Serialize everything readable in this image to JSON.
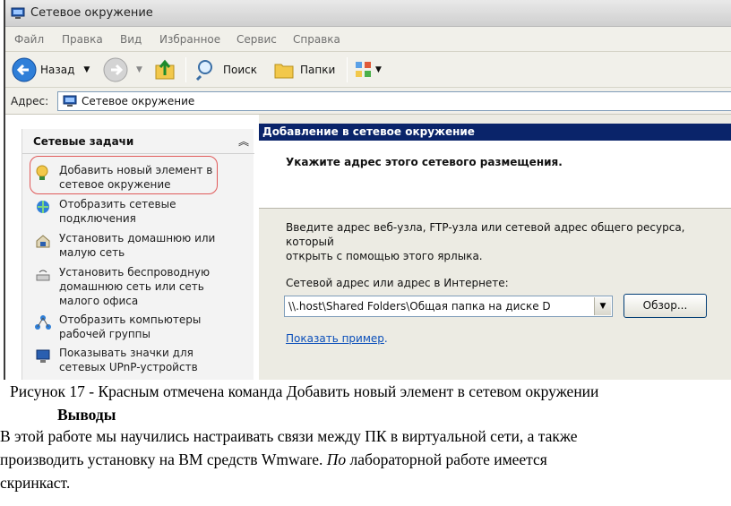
{
  "window": {
    "title": "Сетевое окружение"
  },
  "menu": [
    "Файл",
    "Правка",
    "Вид",
    "Избранное",
    "Сервис",
    "Справка"
  ],
  "toolbar": {
    "back_label": "Назад",
    "search_label": "Поиск",
    "folders_label": "Папки"
  },
  "address": {
    "label": "Адрес:",
    "value": "Сетевое окружение"
  },
  "tasks_panel": {
    "title": "Сетевые задачи",
    "items": [
      {
        "line1": "Добавить новый элемент в",
        "line2": "сетевое окружение",
        "line3": "",
        "icon": "add-network-place-icon"
      },
      {
        "line1": "Отобразить сетевые",
        "line2": "подключения",
        "line3": "",
        "icon": "network-connections-icon"
      },
      {
        "line1": "Установить домашнюю или",
        "line2": "малую сеть",
        "line3": "",
        "icon": "home-network-icon"
      },
      {
        "line1": "Установить беспроводную",
        "line2": "домашнюю сеть или сеть",
        "line3": "малого офиса",
        "icon": "wireless-network-icon"
      },
      {
        "line1": "Отобразить компьютеры",
        "line2": "рабочей группы",
        "line3": "",
        "icon": "workgroup-computers-icon"
      },
      {
        "line1": "Показывать значки для",
        "line2": "сетевых UPnP-устройств",
        "line3": "",
        "icon": "upnp-devices-icon"
      }
    ]
  },
  "wizard": {
    "title": "Добавление в сетевое окружение",
    "heading": "Укажите адрес этого сетевого размещения.",
    "description_line1": "Введите адрес веб-узла, FTP-узла или сетевой адрес общего ресурса, который",
    "description_line2": "открыть с помощью этого ярлыка.",
    "field_label": "Сетевой адрес или адрес в Интернете:",
    "field_value": "\\\\.host\\Shared Folders\\Общая папка на диске D",
    "browse_label": "Обзор...",
    "example_link": "Показать пример",
    "example_suffix": "."
  },
  "document": {
    "caption": "Рисунок 17 - Красным отмечена команда Добавить новый элемент в сетевом окружении",
    "section_heading": "Выводы",
    "paragraph_line1": "В этой работе мы научились настраивать связи между ПК в виртуальной сети, а также",
    "paragraph_line2_a": "производить установку на ВМ средств Wmware. ",
    "paragraph_line2_italic": "По",
    "paragraph_line2_b": " лабораторной работе имеется",
    "paragraph_line3": "скринкаст."
  },
  "colors": {
    "wizard_title_bg": "#0a246a",
    "highlight_border": "#e05a5a",
    "link": "#0b4fba"
  }
}
